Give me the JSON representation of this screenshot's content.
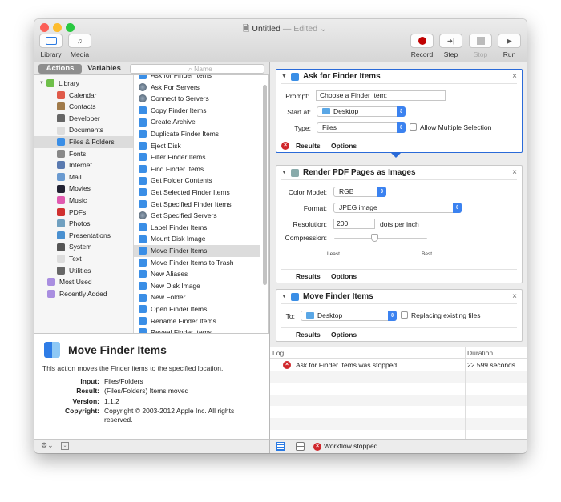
{
  "window": {
    "title": "Untitled",
    "edited": "— Edited ⌄"
  },
  "toolbar": {
    "library": "Library",
    "media": "Media",
    "record": "Record",
    "step": "Step",
    "stop": "Stop",
    "run": "Run"
  },
  "library": {
    "tab_actions": "Actions",
    "tab_variables": "Variables",
    "search_placeholder": "Name",
    "tree": [
      {
        "label": "Library",
        "root": true,
        "color": "#6fbf4a"
      },
      {
        "label": "Calendar",
        "color": "#e05a4a"
      },
      {
        "label": "Contacts",
        "color": "#a07a4a"
      },
      {
        "label": "Developer",
        "color": "#666"
      },
      {
        "label": "Documents",
        "color": "#ddd"
      },
      {
        "label": "Files & Folders",
        "color": "#3a8ee6",
        "selected": true
      },
      {
        "label": "Fonts",
        "color": "#888"
      },
      {
        "label": "Internet",
        "color": "#5a7ab0"
      },
      {
        "label": "Mail",
        "color": "#6a9ad0"
      },
      {
        "label": "Movies",
        "color": "#223"
      },
      {
        "label": "Music",
        "color": "#e05ab0"
      },
      {
        "label": "PDFs",
        "color": "#d03030"
      },
      {
        "label": "Photos",
        "color": "#70a0c0"
      },
      {
        "label": "Presentations",
        "color": "#4a90d0"
      },
      {
        "label": "System",
        "color": "#555"
      },
      {
        "label": "Text",
        "color": "#ddd"
      },
      {
        "label": "Utilities",
        "color": "#666"
      },
      {
        "label": "Most Used",
        "top": true,
        "color": "#a98ee0"
      },
      {
        "label": "Recently Added",
        "top": true,
        "color": "#a98ee0"
      }
    ],
    "actions": [
      "Ask for Finder Items",
      "Ask For Servers",
      "Connect to Servers",
      "Copy Finder Items",
      "Create Archive",
      "Duplicate Finder Items",
      "Eject Disk",
      "Filter Finder Items",
      "Find Finder Items",
      "Get Folder Contents",
      "Get Selected Finder Items",
      "Get Specified Finder Items",
      "Get Specified Servers",
      "Label Finder Items",
      "Mount Disk Image",
      "Move Finder Items",
      "Move Finder Items to Trash",
      "New Aliases",
      "New Disk Image",
      "New Folder",
      "Open Finder Items",
      "Rename Finder Items",
      "Reveal Finder Items"
    ],
    "selected_action": "Move Finder Items"
  },
  "description": {
    "title": "Move Finder Items",
    "text": "This action moves the Finder items to the specified location.",
    "fields": [
      {
        "k": "Input:",
        "v": "Files/Folders"
      },
      {
        "k": "Result:",
        "v": "(Files/Folders) Items moved"
      },
      {
        "k": "Version:",
        "v": "1.1.2"
      },
      {
        "k": "Copyright:",
        "v": "Copyright © 2003-2012 Apple Inc.  All rights reserved."
      }
    ]
  },
  "workflow": {
    "ask": {
      "title": "Ask for Finder Items",
      "prompt_label": "Prompt:",
      "prompt_value": "Choose a Finder Item:",
      "start_label": "Start at:",
      "start_value": "Desktop",
      "type_label": "Type:",
      "type_value": "Files",
      "multi_label": "Allow Multiple Selection",
      "results": "Results",
      "options": "Options"
    },
    "render": {
      "title": "Render PDF Pages as Images",
      "color_label": "Color Model:",
      "color_value": "RGB",
      "format_label": "Format:",
      "format_value": "JPEG image",
      "res_label": "Resolution:",
      "res_value": "200",
      "res_unit": "dots per inch",
      "comp_label": "Compression:",
      "comp_min": "Least",
      "comp_max": "Best",
      "comp_value": 0.43,
      "results": "Results",
      "options": "Options"
    },
    "move": {
      "title": "Move Finder Items",
      "to_label": "To:",
      "to_value": "Desktop",
      "replace_label": "Replacing existing files",
      "results": "Results",
      "options": "Options"
    }
  },
  "log": {
    "col_log": "Log",
    "col_duration": "Duration",
    "entries": [
      {
        "text": "Ask for Finder Items was stopped",
        "duration": "22.599 seconds"
      }
    ],
    "status": "Workflow stopped"
  },
  "colors": {
    "accent": "#2a6ad8",
    "record": "#c00000",
    "error": "#d0262b"
  }
}
